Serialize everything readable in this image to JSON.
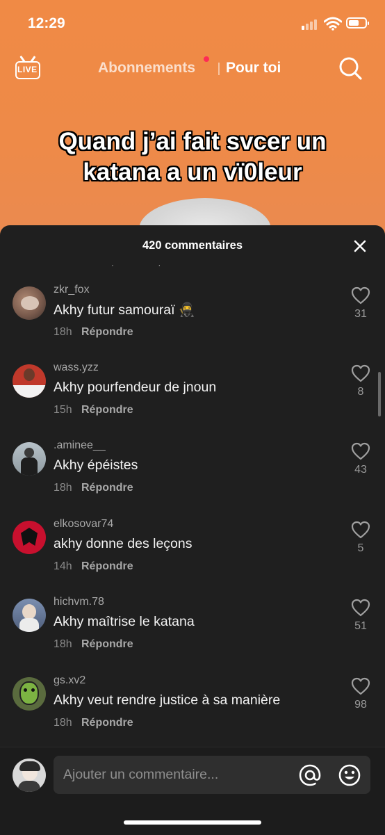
{
  "status_bar": {
    "time": "12:29"
  },
  "top_nav": {
    "live_label": "LIVE",
    "tab_following": "Abonnements",
    "tab_for_you": "Pour toi"
  },
  "video": {
    "caption_line1": "Quand j’ai fait svcer un",
    "caption_line2": "katana a un vï0leur"
  },
  "comments_sheet": {
    "title": "420 commentaires",
    "comments": [
      {
        "username": "zkr_fox",
        "text": "Akhy futur samouraï 🥷",
        "time": "18h",
        "reply": "Répondre",
        "likes": "31"
      },
      {
        "username": "wass.yzz",
        "text": "Akhy pourfendeur de jnoun",
        "time": "15h",
        "reply": "Répondre",
        "likes": "8"
      },
      {
        "username": ".aminee__",
        "text": "Akhy épéistes",
        "time": "18h",
        "reply": "Répondre",
        "likes": "43"
      },
      {
        "username": "elkosovar74",
        "text": "akhy donne des leçons",
        "time": "14h",
        "reply": "Répondre",
        "likes": "5"
      },
      {
        "username": "hichvm.78",
        "text": "Akhy maîtrise le katana",
        "time": "18h",
        "reply": "Répondre",
        "likes": "51"
      },
      {
        "username": "gs.xv2",
        "text": "Akhy veut rendre justice à sa manière",
        "time": "18h",
        "reply": "Répondre",
        "likes": "98"
      }
    ]
  },
  "input": {
    "placeholder": "Ajouter un commentaire..."
  },
  "colors": {
    "video_bg": "#ef8a47",
    "sheet_bg": "#1f1f1f",
    "accent_dot": "#fe2c55"
  }
}
